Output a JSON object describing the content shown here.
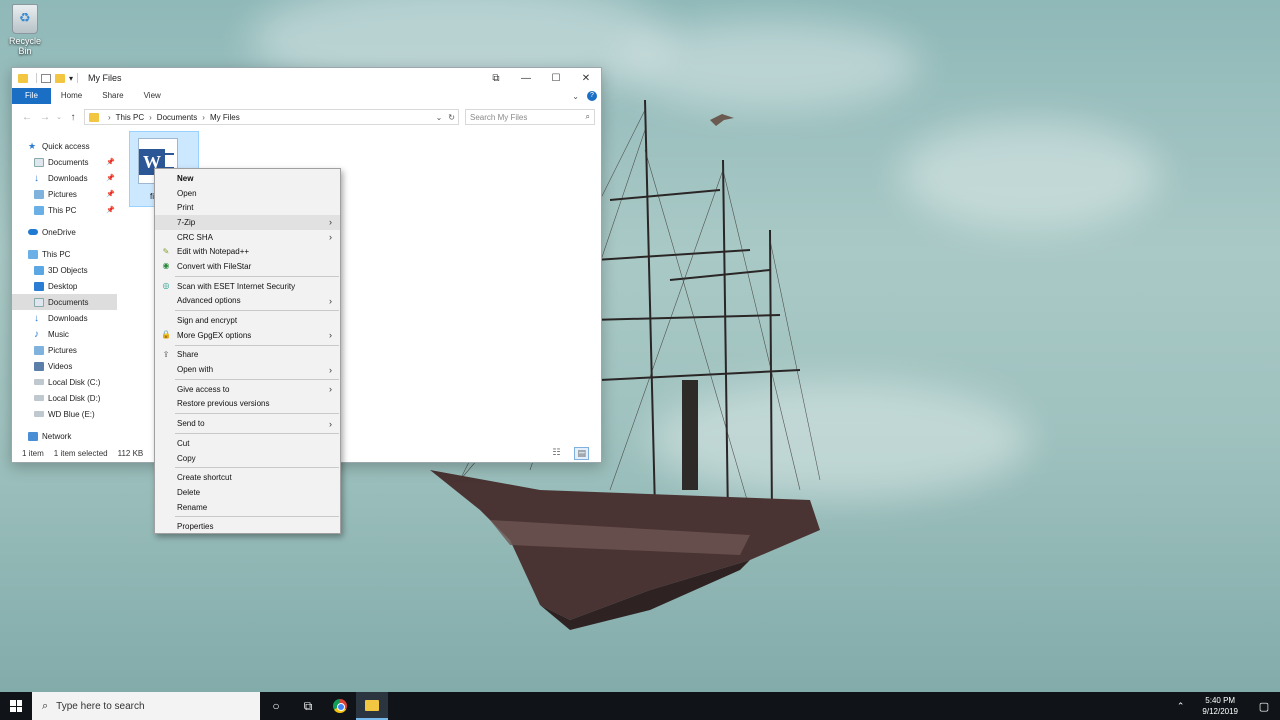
{
  "desktop": {
    "recycle_bin_label": "Recycle Bin"
  },
  "explorer": {
    "title": "My Files",
    "ribbon_tabs": [
      "File",
      "Home",
      "Share",
      "View"
    ],
    "breadcrumb": [
      "This PC",
      "Documents",
      "My Files"
    ],
    "search_placeholder": "Search My Files",
    "nav": {
      "quick_access": "Quick access",
      "quick_items": [
        "Documents",
        "Downloads",
        "Pictures",
        "This PC"
      ],
      "onedrive": "OneDrive",
      "this_pc": "This PC",
      "pc_items": [
        "3D Objects",
        "Desktop",
        "Documents",
        "Downloads",
        "Music",
        "Pictures",
        "Videos",
        "Local Disk (C:)",
        "Local Disk (D:)",
        "WD Blue (E:)"
      ],
      "network": "Network"
    },
    "file_name": "fi",
    "status": {
      "count": "1 item",
      "selected": "1 item selected",
      "size": "112 KB"
    }
  },
  "context_menu": {
    "new": "New",
    "open": "Open",
    "print": "Print",
    "zip": "7-Zip",
    "crc": "CRC SHA",
    "notepad": "Edit with Notepad++",
    "filestar": "Convert with FileStar",
    "eset": "Scan with ESET Internet Security",
    "advanced": "Advanced options",
    "sign": "Sign and encrypt",
    "gpgex": "More GpgEX options",
    "share": "Share",
    "open_with": "Open with",
    "give_access": "Give access to",
    "restore": "Restore previous versions",
    "send_to": "Send to",
    "cut": "Cut",
    "copy": "Copy",
    "shortcut": "Create shortcut",
    "delete": "Delete",
    "rename": "Rename",
    "properties": "Properties"
  },
  "taskbar": {
    "search_placeholder": "Type here to search",
    "time": "5:40 PM",
    "date": "9/12/2019"
  },
  "colors": {
    "accent": "#1a6fc4",
    "selection": "#cce8ff",
    "taskbar": "#101418"
  }
}
